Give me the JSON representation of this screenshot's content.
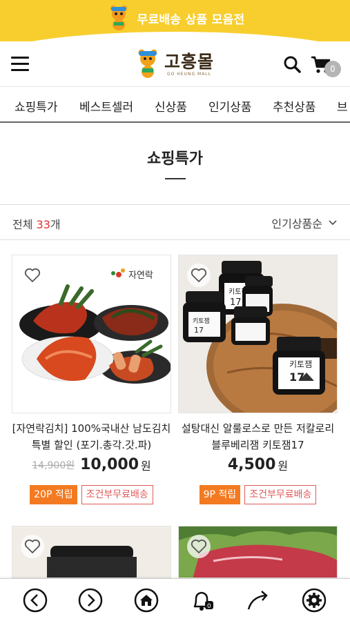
{
  "banner": {
    "text": "무료배송 상품 모음전",
    "mascot_icon": "tiger-mascot-icon"
  },
  "header": {
    "logo_text": "고흥몰",
    "logo_sub": "GO HEUNG MALL",
    "cart_count": "0"
  },
  "nav": {
    "items": [
      {
        "label": "쇼핑특가"
      },
      {
        "label": "베스트셀러"
      },
      {
        "label": "신상품"
      },
      {
        "label": "인기상품"
      },
      {
        "label": "추천상품"
      },
      {
        "label": "브"
      }
    ]
  },
  "page": {
    "title": "쇼핑특가",
    "count_prefix": "전체 ",
    "count_value": "33",
    "count_suffix": "개",
    "sort_label": "인기상품순"
  },
  "products": [
    {
      "name": "[자연락김치] 100%국내산 남도김치 특별 할인 (포기.총각.갓.파)",
      "brand_mark": "자연락",
      "old_price": "14,900원",
      "price": "10,000",
      "won": "원",
      "point": "20P 적립",
      "shipping": "조건부무료배송"
    },
    {
      "name": "설탕대신 알룰로스로 만든 저칼로리 블루베리잼 키토잼17",
      "jar_label": "키토잼",
      "jar_num": "17",
      "old_price": "",
      "price": "4,500",
      "won": "원",
      "point": "9P 적립",
      "shipping": "조건부무료배송"
    }
  ],
  "colors": {
    "banner": "#f7ce2e",
    "accent_orange": "#f37a20",
    "count_red": "#e03030",
    "ship_red": "#e05a5a"
  }
}
